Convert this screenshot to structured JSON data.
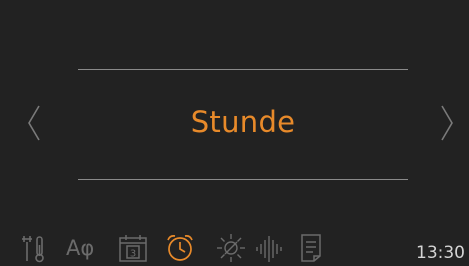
{
  "main": {
    "value_label": "Stunde"
  },
  "navigation": {
    "prev_icon": "chevron-left-icon",
    "next_icon": "chevron-right-icon"
  },
  "toolbar": {
    "items": [
      {
        "icon": "tools-icon",
        "active": false
      },
      {
        "label": "Aφ",
        "icon": "language-icon",
        "active": false
      },
      {
        "icon": "calendar-icon",
        "calendar_day": "3",
        "active": false
      },
      {
        "icon": "alarm-clock-icon",
        "active": true
      },
      {
        "icon": "brightness-icon",
        "active": false
      },
      {
        "icon": "sound-wave-icon",
        "active": false
      },
      {
        "icon": "document-icon",
        "active": false
      }
    ],
    "time": "13:30"
  },
  "colors": {
    "background": "#222222",
    "accent": "#e88a2a",
    "divider": "#8a8a8a",
    "inactive_icon": "#6b6b6b",
    "time_text": "#d4d4d4"
  }
}
